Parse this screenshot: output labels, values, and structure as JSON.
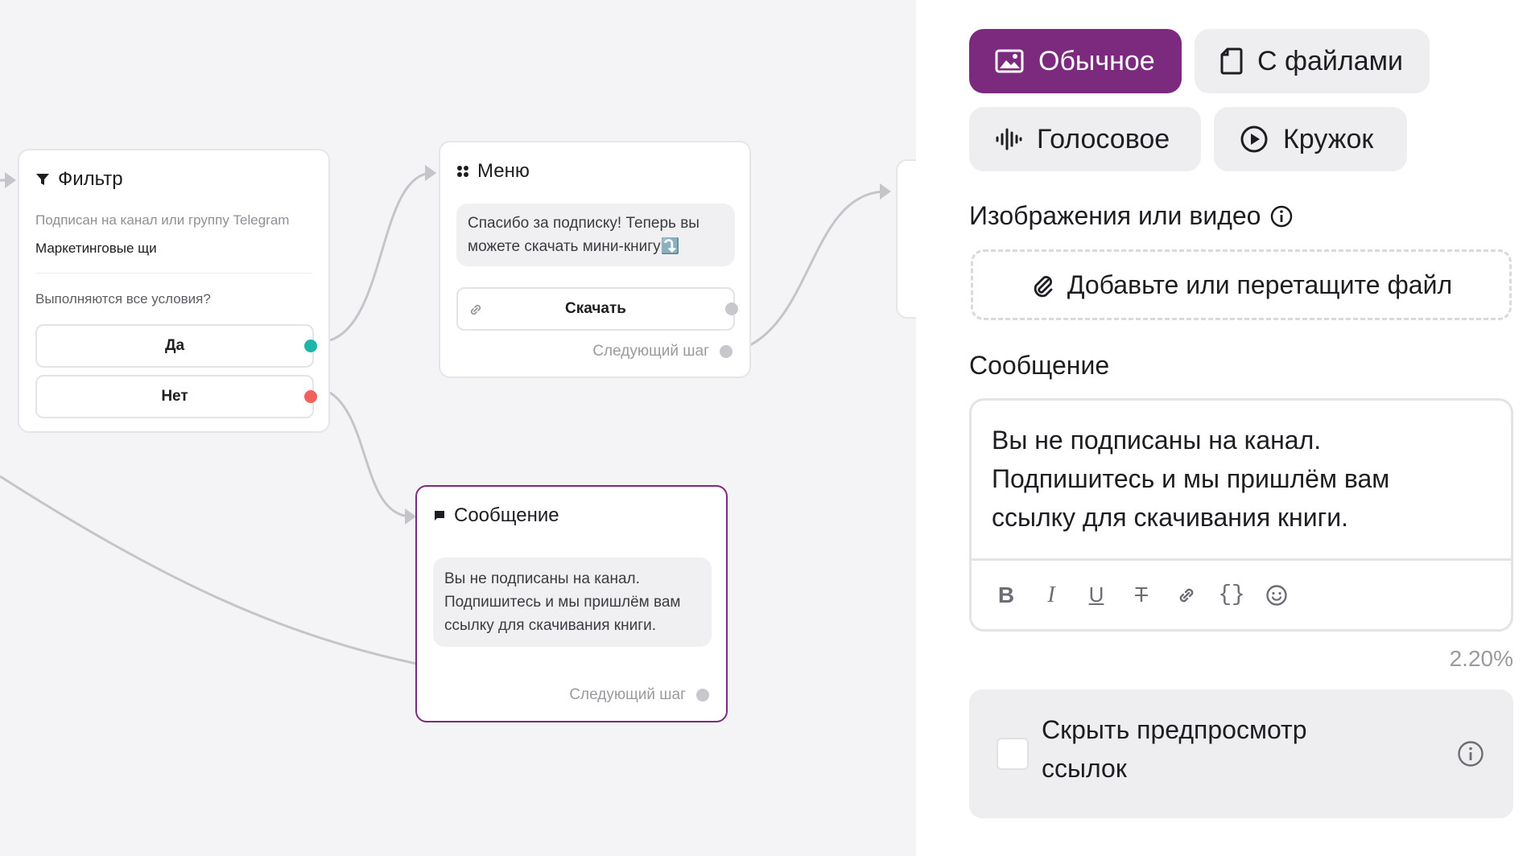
{
  "canvas": {
    "filter_node": {
      "title": "Фильтр",
      "condition_label": "Подписан на канал или группу Telegram",
      "condition_value": "Маркетинговые щи",
      "question": "Выполняются все условия?",
      "yes_label": "Да",
      "no_label": "Нет"
    },
    "menu_node": {
      "title": "Меню",
      "message": "Спасибо за подписку! Теперь вы можете скачать мини-книгу⤵️",
      "button_label": "Скачать",
      "next_step": "Следующий шаг"
    },
    "message_node": {
      "title": "Сообщение",
      "message": "Вы не подписаны на канал. Подпишитесь и мы пришлём вам ссылку для скачивания книги.",
      "next_step": "Следующий шаг"
    }
  },
  "panel": {
    "message_types": [
      {
        "label": "Обычное",
        "icon": "image-icon",
        "active": true
      },
      {
        "label": "С файлами",
        "icon": "file-icon",
        "active": false
      },
      {
        "label": "Голосовое",
        "icon": "voice-wave-icon",
        "active": false
      },
      {
        "label": "Кружок",
        "icon": "play-circle-icon",
        "active": false
      }
    ],
    "media_title": "Изображения или видео",
    "dropzone_label": "Добавьте или перетащите файл",
    "message_title": "Сообщение",
    "message_text": "Вы не подписаны на канал.\nПодпишитесь и мы пришлём вам\nссылку для скачивания книги.",
    "toolbar": {
      "bold": "B",
      "italic": "I",
      "underline": "U",
      "strike": "T",
      "code": "{}"
    },
    "counter": "2.20%",
    "hide_preview_label": "Скрыть предпросмотр ссылок"
  },
  "colors": {
    "accent": "#7b2a7d",
    "port_yes": "#1fb5a8",
    "port_no": "#f2605a",
    "port_default": "#c7c7cc"
  }
}
